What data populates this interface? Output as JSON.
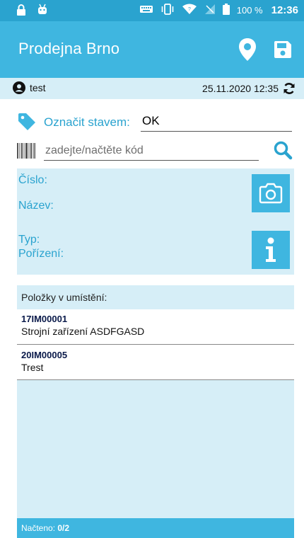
{
  "status_bar": {
    "battery_percent": "100 %",
    "time": "12:36"
  },
  "app_bar": {
    "title": "Prodejna Brno"
  },
  "user_row": {
    "user": "test",
    "datetime": "25.11.2020 12:35"
  },
  "form": {
    "state_label": "Označit stavem:",
    "state_value": "OK",
    "code_placeholder": "zadejte/načtěte kód"
  },
  "detail": {
    "cislo_label": "Číslo:",
    "nazev_label": "Název:",
    "typ_label": "Typ:",
    "porizeni_label": "Pořízení:"
  },
  "items": {
    "header": "Položky v umístění:",
    "list": [
      {
        "code": "17IM00001",
        "name": "Strojní zařízení ASDFGASD"
      },
      {
        "code": "20IM00005",
        "name": "Trest"
      }
    ],
    "footer_label": "Načteno:",
    "footer_count": "0/2"
  },
  "colors": {
    "primary": "#3fb6e0",
    "status_bar": "#2aa3cf",
    "panel": "#d6eef7",
    "accent_text": "#2aa3cf"
  },
  "icons": [
    "lock-icon",
    "android-icon",
    "keyboard-icon",
    "vibrate-icon",
    "wifi-icon",
    "no-signal-icon",
    "battery-icon",
    "map-marker-icon",
    "save-icon",
    "user-icon",
    "sync-icon",
    "tag-icon",
    "barcode-icon",
    "search-icon",
    "camera-icon",
    "info-icon"
  ]
}
